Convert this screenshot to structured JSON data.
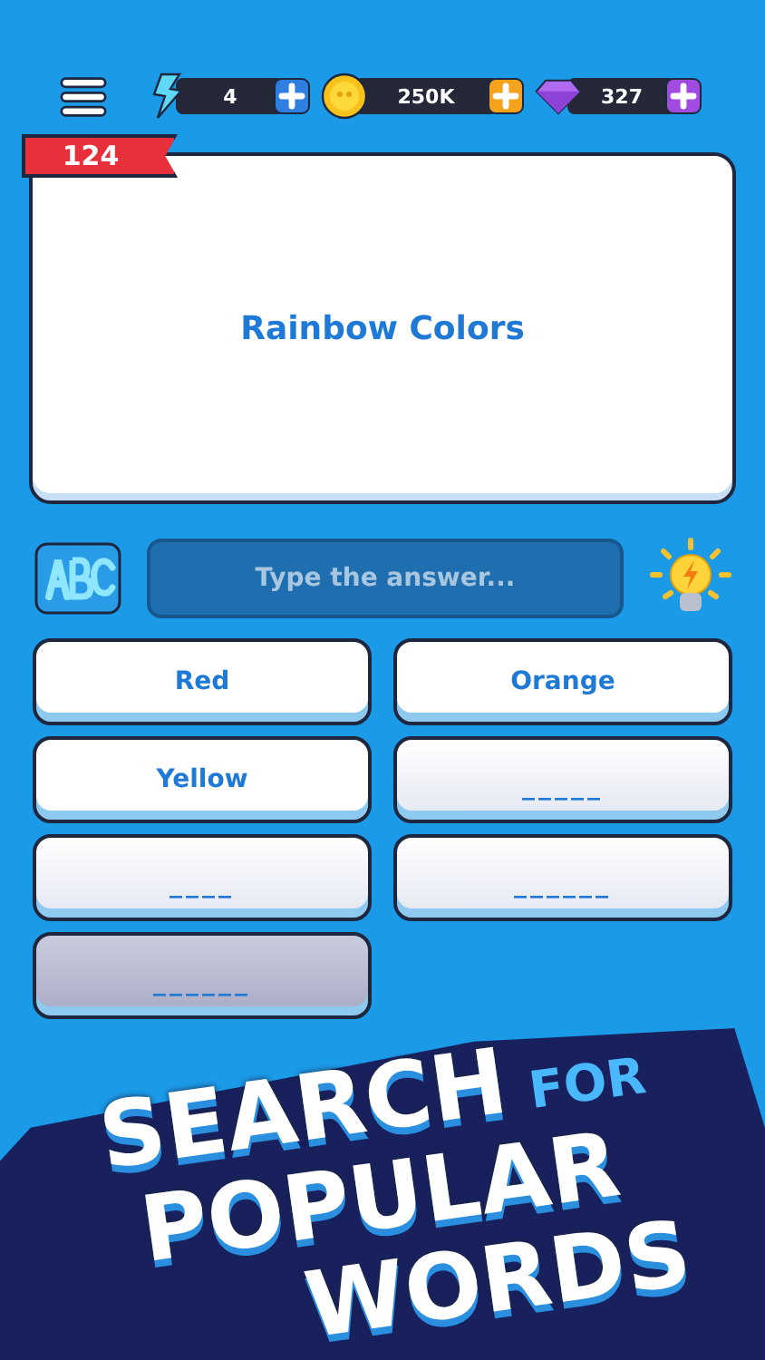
{
  "currencies": [
    {
      "kind": "energy",
      "amount": "4"
    },
    {
      "kind": "coins",
      "amount": "250K"
    },
    {
      "kind": "gems",
      "amount": "327"
    }
  ],
  "level": "124",
  "category": "Rainbow Colors",
  "answer_field": {
    "placeholder": "Type the answer..."
  },
  "answers": [
    {
      "text": "Red",
      "revealed": true
    },
    {
      "text": "Orange",
      "revealed": true
    },
    {
      "text": "Yellow",
      "revealed": true
    },
    {
      "text": "_____",
      "revealed": false
    },
    {
      "text": "____",
      "revealed": false
    },
    {
      "text": "______",
      "revealed": false
    },
    {
      "text": "______",
      "revealed": false
    }
  ],
  "headline": [
    {
      "text": "SEARCH",
      "kind": "big"
    },
    {
      "text": "FOR",
      "kind": "small"
    },
    {
      "text": "POPULAR",
      "kind": "big"
    },
    {
      "text": "WORDS",
      "kind": "big"
    }
  ]
}
